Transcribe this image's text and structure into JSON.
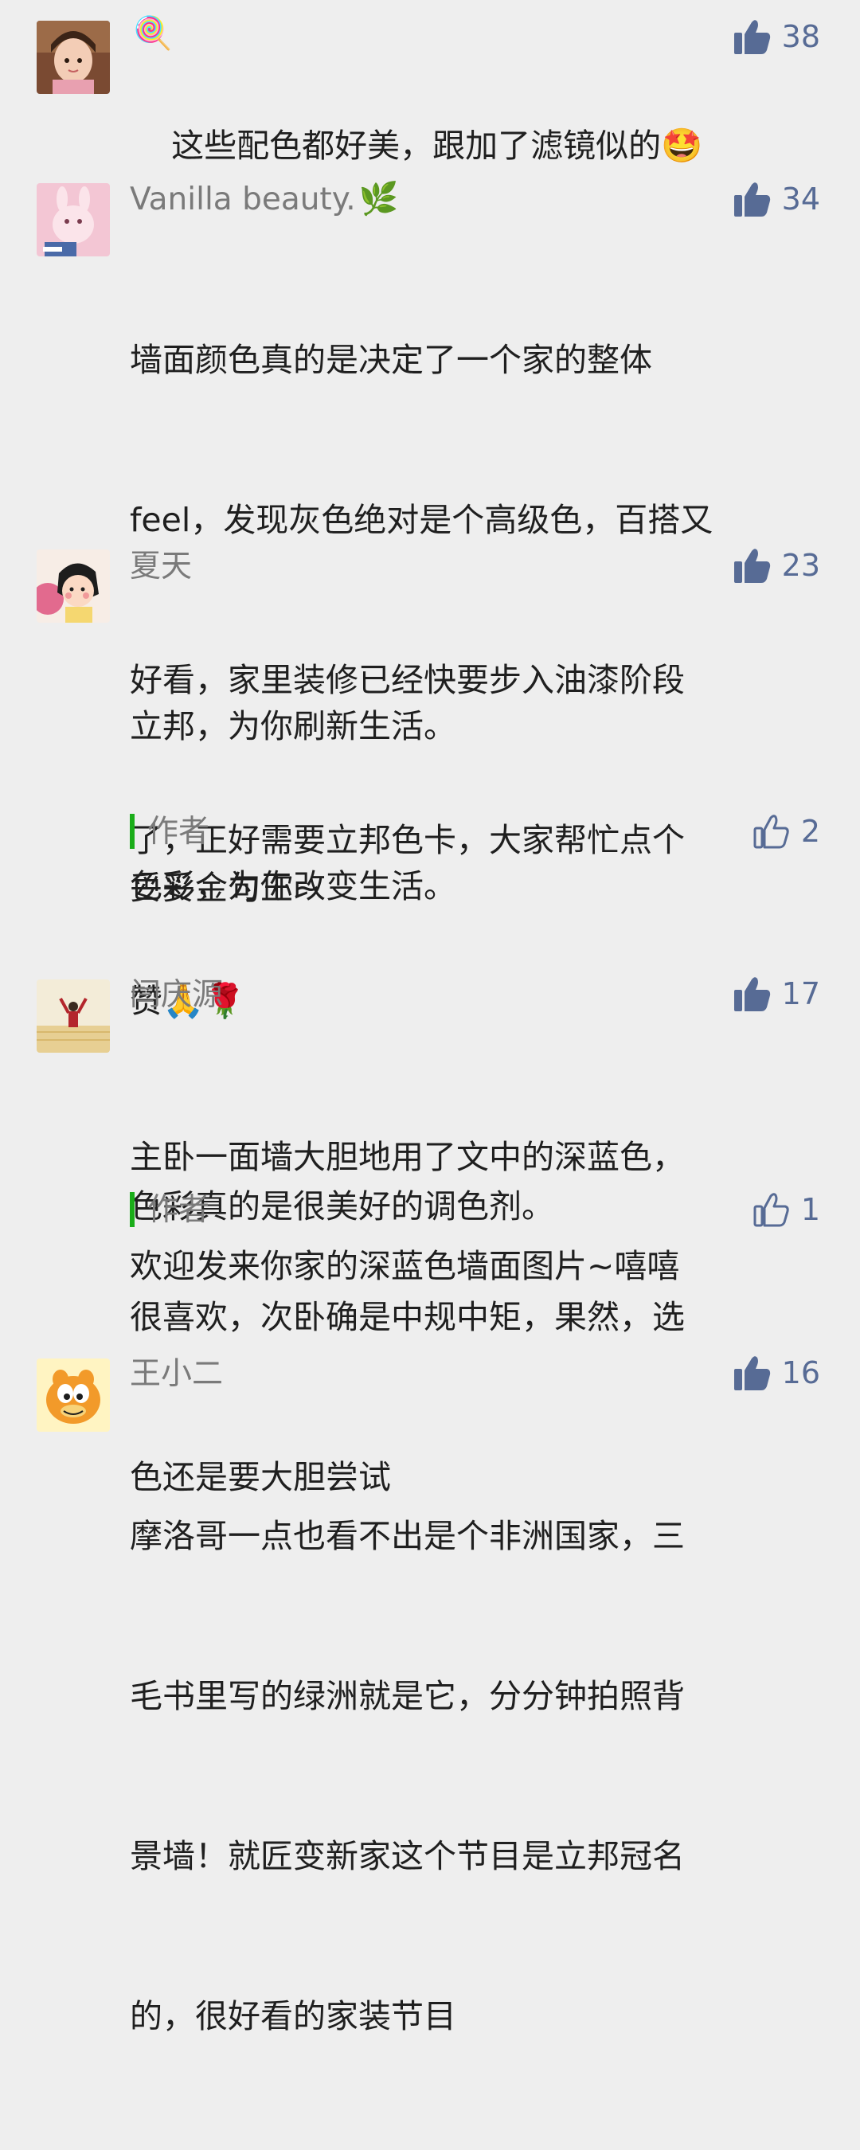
{
  "colors": {
    "background": "#eeeeee",
    "like_blue": "#576b95",
    "author_green": "#1aad19",
    "name_gray": "#7a7a7a",
    "text": "#1f1f1f"
  },
  "comments": [
    {
      "name": "",
      "name_emoji": "🍭",
      "likes": "38",
      "like_icon": "thumbs-up-filled-icon",
      "text": "这些配色都好美，跟加了滤镜似的",
      "text_emoji": "🤩"
    },
    {
      "name": "Vanilla beauty.",
      "name_emoji": "🌿",
      "likes": "34",
      "like_icon": "thumbs-up-filled-icon",
      "text_lines": [
        "墙面颜色真的是决定了一个家的整体",
        "feel，发现灰色绝对是个高级色，百搭又",
        "好看，家里装修已经快要步入油漆阶段",
        "了，正好需要立邦色卡，大家帮忙点个",
        "赞"
      ],
      "text_emoji": "🙏🌹"
    },
    {
      "name": "夏天",
      "likes": "23",
      "like_icon": "thumbs-up-filled-icon",
      "text_lines": [
        "立邦，为你刷新生活。",
        "色彩，为你改变生活。",
        "",
        "色彩真的是很美好的调色剂。"
      ],
      "reply": {
        "author_label": "作者",
        "likes": "2",
        "like_icon": "thumbs-up-outline-icon",
        "text": "妥妥金句王~"
      }
    },
    {
      "name": "闫庆源",
      "likes": "17",
      "like_icon": "thumbs-up-filled-icon",
      "text_lines": [
        "主卧一面墙大胆地用了文中的深蓝色，",
        "很喜欢，次卧确是中规中矩，果然，选",
        "色还是要大胆尝试"
      ],
      "reply": {
        "author_label": "作者",
        "likes": "1",
        "like_icon": "thumbs-up-outline-icon",
        "text": "欢迎发来你家的深蓝色墙面图片~嘻嘻"
      }
    },
    {
      "name": "王小二",
      "likes": "16",
      "like_icon": "thumbs-up-filled-icon",
      "text_lines": [
        "摩洛哥一点也看不出是个非洲国家，三",
        "毛书里写的绿洲就是它，分分钟拍照背",
        "景墙！就匠变新家这个节目是立邦冠名",
        "的，很好看的家装节目"
      ]
    }
  ]
}
